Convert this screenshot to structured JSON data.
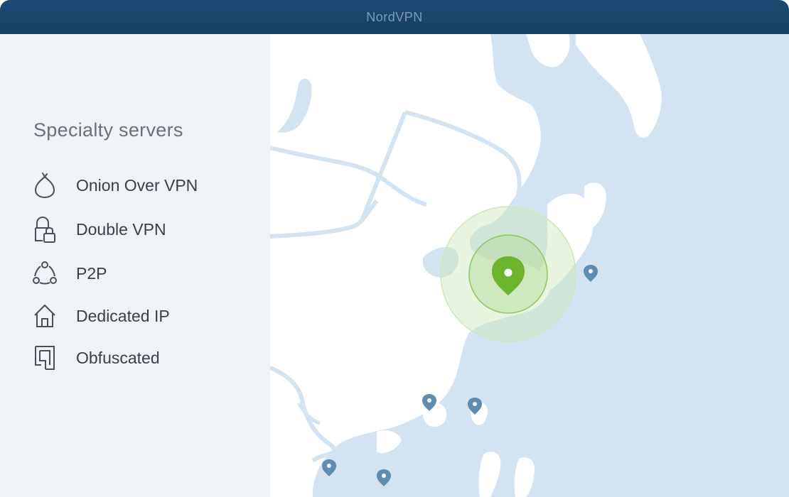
{
  "window": {
    "title": "NordVPN"
  },
  "sidebar": {
    "heading": "Specialty servers",
    "items": [
      {
        "label": "Onion Over VPN",
        "icon": "onion-icon"
      },
      {
        "label": "Double VPN",
        "icon": "double-lock-icon"
      },
      {
        "label": "P2P",
        "icon": "p2p-icon"
      },
      {
        "label": "Dedicated IP",
        "icon": "house-icon"
      },
      {
        "label": "Obfuscated",
        "icon": "obfuscated-icon"
      }
    ]
  },
  "map": {
    "colors": {
      "water": "#d3e3f2",
      "land": "#ffffff",
      "border": "#d3e3f2",
      "active_pin": "#6cb32e",
      "server_pin": "#5f8db2"
    },
    "active_location": {
      "state": "connected"
    },
    "server_pins": 6
  }
}
